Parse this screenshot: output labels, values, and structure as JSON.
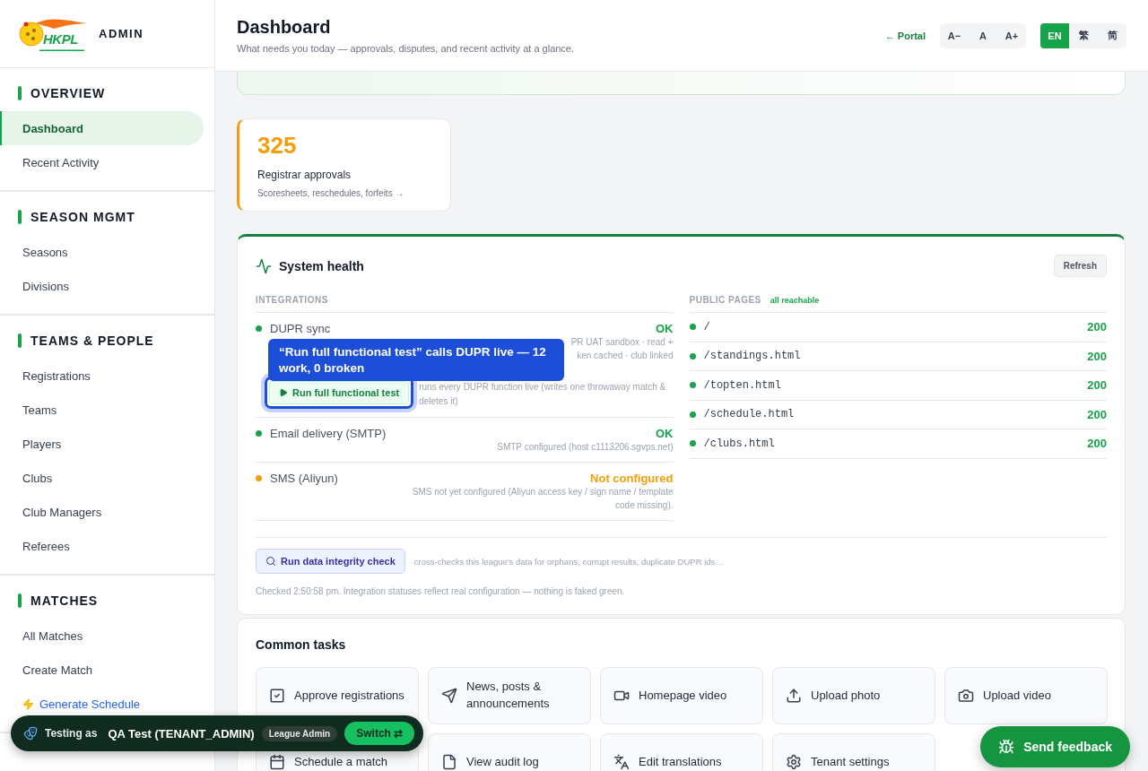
{
  "brand": {
    "logo_text": "HKPL",
    "label": "ADMIN"
  },
  "sidebar": {
    "sections": [
      {
        "title": "OVERVIEW",
        "items": [
          {
            "label": "Dashboard",
            "selected": true,
            "kind": "link"
          },
          {
            "label": "Recent Activity",
            "selected": false,
            "kind": "link"
          }
        ]
      },
      {
        "title": "SEASON MGMT",
        "items": [
          {
            "label": "Seasons",
            "selected": false,
            "kind": "link"
          },
          {
            "label": "Divisions",
            "selected": false,
            "kind": "link"
          }
        ]
      },
      {
        "title": "TEAMS & PEOPLE",
        "items": [
          {
            "label": "Registrations",
            "selected": false,
            "kind": "link"
          },
          {
            "label": "Teams",
            "selected": false,
            "kind": "link"
          },
          {
            "label": "Players",
            "selected": false,
            "kind": "link"
          },
          {
            "label": "Clubs",
            "selected": false,
            "kind": "link"
          },
          {
            "label": "Club Managers",
            "selected": false,
            "kind": "link"
          },
          {
            "label": "Referees",
            "selected": false,
            "kind": "link"
          }
        ]
      },
      {
        "title": "MATCHES",
        "items": [
          {
            "label": "All Matches",
            "selected": false,
            "kind": "link"
          },
          {
            "label": "Create Match",
            "selected": false,
            "kind": "link"
          },
          {
            "label": "Generate Schedule",
            "selected": false,
            "kind": "action"
          }
        ]
      }
    ]
  },
  "header": {
    "title": "Dashboard",
    "subtitle": "What needs you today — approvals, disputes, and recent activity at a glance.",
    "portal_link": "← Portal",
    "font_sizes": [
      "A−",
      "A",
      "A+"
    ],
    "languages": [
      {
        "label": "EN",
        "selected": true
      },
      {
        "label": "繁",
        "selected": false
      },
      {
        "label": "简",
        "selected": false
      }
    ]
  },
  "stat_card": {
    "value": "325",
    "title": "Registrar approvals",
    "subtitle": "Scoresheets, reschedules, forfeits →"
  },
  "system_health": {
    "title": "System health",
    "refresh": "Refresh",
    "integrations_heading": "INTEGRATIONS",
    "integrations": [
      {
        "name": "DUPR sync",
        "status": "OK",
        "color": "#16a34a",
        "detail_lines": [
          "PR UAT sandbox · read +",
          "ken cached · club linked"
        ],
        "action": {
          "label": "Run full functional test",
          "description": "runs every DUPR function live (writes one throwaway match & deletes it)"
        }
      },
      {
        "name": "Email delivery (SMTP)",
        "status": "OK",
        "color": "#16a34a",
        "detail_lines": [
          "SMTP configured (host c1113206.sgvps.net)"
        ]
      },
      {
        "name": "SMS (Aliyun)",
        "status": "Not configured",
        "color": "#f59e0b",
        "detail_lines": [
          "SMS not yet configured (Aliyun access key / sign name / template code missing)."
        ]
      }
    ],
    "tour_tip": "“Run full functional test” calls DUPR live — 12 work, 0 broken",
    "pages_heading": "PUBLIC PAGES",
    "pages_note": "all reachable",
    "pages": [
      {
        "path": "/",
        "code": "200",
        "color": "#16a34a"
      },
      {
        "path": "/standings.html",
        "code": "200",
        "color": "#16a34a"
      },
      {
        "path": "/topten.html",
        "code": "200",
        "color": "#16a34a"
      },
      {
        "path": "/schedule.html",
        "code": "200",
        "color": "#16a34a"
      },
      {
        "path": "/clubs.html",
        "code": "200",
        "color": "#16a34a"
      }
    ],
    "integrity_button": "Run data integrity check",
    "integrity_note": "cross-checks this league's data for orphans, corrupt results, duplicate DUPR ids…",
    "checked_note": "Checked 2:50:58 pm. Integration statuses reflect real configuration — nothing is faked green."
  },
  "common_tasks": {
    "title": "Common tasks",
    "tasks": [
      "Approve registrations",
      "News, posts & announcements",
      "Homepage video",
      "Upload photo",
      "Upload video",
      "Schedule a match",
      "View audit log",
      "Edit translations",
      "Tenant settings"
    ]
  },
  "testing_bar": {
    "prefix": "Testing as",
    "user": "QA Test (TENANT_ADMIN)",
    "role": "League Admin",
    "switch": "Switch ⇄"
  },
  "feedback_button": "Send feedback"
}
